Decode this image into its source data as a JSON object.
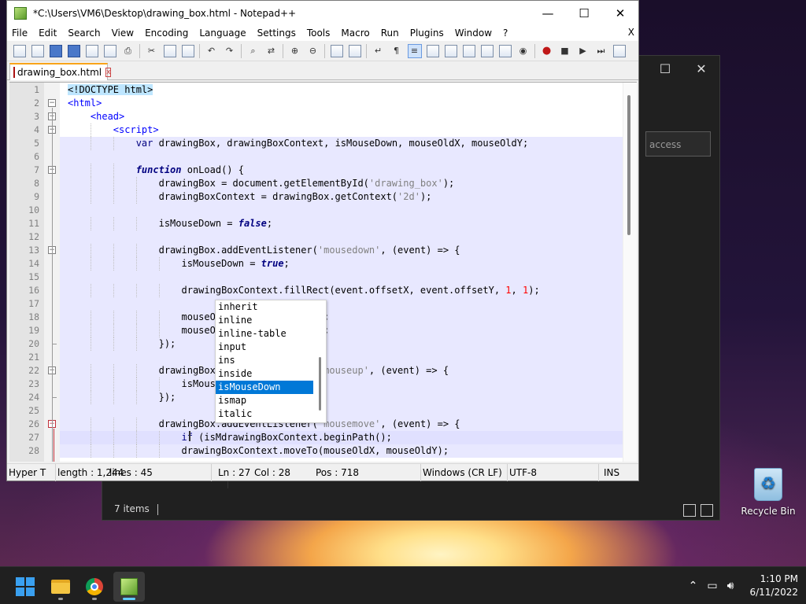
{
  "window": {
    "title": "*C:\\Users\\VM6\\Desktop\\drawing_box.html - Notepad++",
    "minimize": "—",
    "maximize": "☐",
    "close": "✕"
  },
  "menu": {
    "items": [
      "File",
      "Edit",
      "Search",
      "View",
      "Encoding",
      "Language",
      "Settings",
      "Tools",
      "Macro",
      "Run",
      "Plugins",
      "Window",
      "?"
    ],
    "close_doc": "X"
  },
  "tab": {
    "label": "drawing_box.html",
    "close": "x"
  },
  "code_lines": [
    {
      "n": "1",
      "t": "<!DOCTYPE html>"
    },
    {
      "n": "2",
      "t": "<html>"
    },
    {
      "n": "3",
      "t": "    <head>"
    },
    {
      "n": "4",
      "t": "        <script>"
    },
    {
      "n": "5",
      "t": "            var drawingBox, drawingBoxContext, isMouseDown, mouseOldX, mouseOldY;"
    },
    {
      "n": "6",
      "t": ""
    },
    {
      "n": "7",
      "t": "            function onLoad() {"
    },
    {
      "n": "8",
      "t": "                drawingBox = document.getElementById('drawing_box');"
    },
    {
      "n": "9",
      "t": "                drawingBoxContext = drawingBox.getContext('2d');"
    },
    {
      "n": "10",
      "t": ""
    },
    {
      "n": "11",
      "t": "                isMouseDown = false;"
    },
    {
      "n": "12",
      "t": ""
    },
    {
      "n": "13",
      "t": "                drawingBox.addEventListener('mousedown', (event) => {"
    },
    {
      "n": "14",
      "t": "                    isMouseDown = true;"
    },
    {
      "n": "15",
      "t": ""
    },
    {
      "n": "16",
      "t": "                    drawingBoxContext.fillRect(event.offsetX, event.offsetY, 1, 1);"
    },
    {
      "n": "17",
      "t": ""
    },
    {
      "n": "18",
      "t": "                    mouseOldX = event.offsetX;"
    },
    {
      "n": "19",
      "t": "                    mouseOldY = event.offsetY;"
    },
    {
      "n": "20",
      "t": "                });"
    },
    {
      "n": "21",
      "t": ""
    },
    {
      "n": "22",
      "t": "                drawingBox.addEventListener('mouseup', (event) => {"
    },
    {
      "n": "23",
      "t": "                    isMouseDown = false;"
    },
    {
      "n": "24",
      "t": "                });"
    },
    {
      "n": "25",
      "t": ""
    },
    {
      "n": "26",
      "t": "                drawingBox.addEventListener('mousemove', (event) => {"
    },
    {
      "n": "27",
      "t": "                    if (isMdrawingBoxContext.beginPath();"
    },
    {
      "n": "28",
      "t": "                    drawingBoxContext.moveTo(mouseOldX, mouseOldY);"
    }
  ],
  "autocomplete": {
    "items": [
      "inherit",
      "inline",
      "inline-table",
      "input",
      "ins",
      "inside",
      "isMouseDown",
      "ismap",
      "italic"
    ],
    "selected": "isMouseDown"
  },
  "status": {
    "type": "Hyper T",
    "length": "length : 1,244",
    "lines": "lines : 45",
    "ln": "Ln : 27",
    "col": "Col : 28",
    "pos": "Pos : 718",
    "eol": "Windows (CR LF)",
    "encoding": "UTF-8",
    "mode": "INS"
  },
  "explorer": {
    "search_placeholder": "access",
    "status": "7 items"
  },
  "desktop": {
    "recycle_bin_label": "Recycle Bin"
  },
  "taskbar": {
    "time": "1:10 PM",
    "date": "6/11/2022"
  },
  "colors": {
    "accent": "#0078d7",
    "tab_accent": "#f8a41a",
    "caret_line": "#e8e8ff"
  }
}
